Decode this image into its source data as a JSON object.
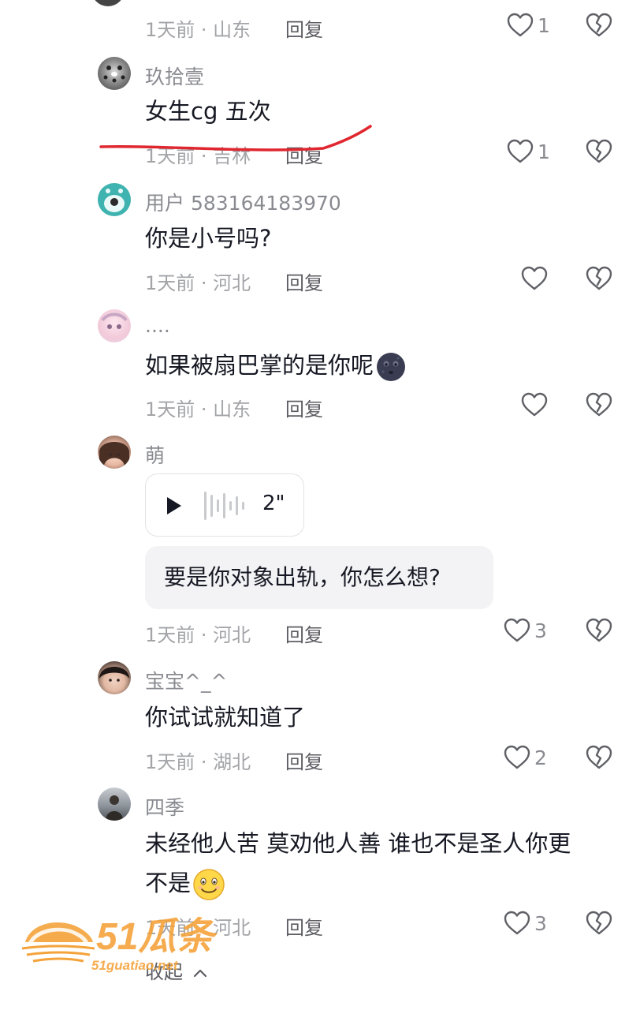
{
  "comments": [
    {
      "username": "",
      "content": "",
      "meta": "1天前 · 山东",
      "reply": "回复",
      "likes": "1"
    },
    {
      "username": "玖拾壹",
      "content": "女生cg 五次",
      "meta": "1天前 · 吉林",
      "reply": "回复",
      "likes": "1"
    },
    {
      "username": "用户 583164183970",
      "content": "你是小号吗?",
      "meta": "1天前 · 河北",
      "reply": "回复",
      "likes": ""
    },
    {
      "username": "....",
      "content": "如果被扇巴掌的是你呢",
      "meta": "1天前 · 山东",
      "reply": "回复",
      "likes": ""
    },
    {
      "username": "萌",
      "voice_duration": "2\"",
      "content": "要是你对象出轨，你怎么想?",
      "meta": "1天前 · 河北",
      "reply": "回复",
      "likes": "3"
    },
    {
      "username": "宝宝^_^",
      "content": "你试试就知道了",
      "meta": "1天前 · 湖北",
      "reply": "回复",
      "likes": "2"
    },
    {
      "username": "四季",
      "content_line1": "未经他人苦  莫劝他人善 谁也不是圣人你更",
      "content_line2": "不是",
      "meta": "1天前 · 河北",
      "reply": "回复",
      "likes": "3"
    }
  ],
  "collapse_label": "收起",
  "watermark": {
    "brand": "51瓜条",
    "url": "51guatiao.net"
  },
  "icons": {
    "like": "heart-outline-icon",
    "dislike": "broken-heart-icon",
    "play": "play-icon",
    "waveform": "waveform-icon",
    "collapse": "chevron-up-icon"
  },
  "colors": {
    "text_primary": "#161823",
    "text_secondary": "#a3a4a8",
    "annotation_red": "#e0262f",
    "watermark": "#f4a33b"
  }
}
